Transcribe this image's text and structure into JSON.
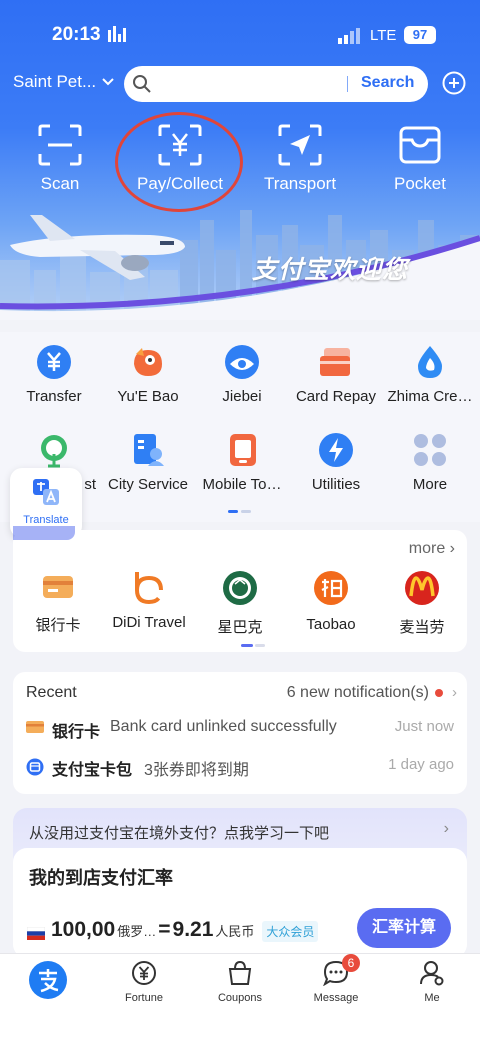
{
  "status": {
    "time": "20:13",
    "network": "LTE",
    "battery": "97"
  },
  "topbar": {
    "city": "Saint Pet...",
    "search_button": "Search"
  },
  "quick": [
    {
      "label": "Scan",
      "icon": "scan-icon"
    },
    {
      "label": "Pay/Collect",
      "icon": "yuan-qr-icon"
    },
    {
      "label": "Transport",
      "icon": "transport-arrow-icon"
    },
    {
      "label": "Pocket",
      "icon": "wallet-icon"
    }
  ],
  "banner": {
    "text": "支付宝欢迎您"
  },
  "grid": [
    {
      "label": "Transfer",
      "icon": "transfer-icon"
    },
    {
      "label": "Yu'E Bao",
      "icon": "yuebao-icon"
    },
    {
      "label": "Jiebei",
      "icon": "jiebei-icon"
    },
    {
      "label": "Card Repay",
      "icon": "card-repay-icon"
    },
    {
      "label": "Zhima Cre…",
      "icon": "zhima-credit-icon"
    },
    {
      "label": "st",
      "icon": "forest-icon"
    },
    {
      "label": "City Service",
      "icon": "city-service-icon"
    },
    {
      "label": "Mobile To…",
      "icon": "mobile-topup-icon"
    },
    {
      "label": "Utilities",
      "icon": "utilities-icon"
    },
    {
      "label": "More",
      "icon": "more-grid-icon"
    }
  ],
  "translate": {
    "label": "Translate"
  },
  "brands": {
    "more": "more",
    "items": [
      {
        "label": "银行卡",
        "icon": "bank-card-icon"
      },
      {
        "label": "DiDi Travel",
        "icon": "didi-icon"
      },
      {
        "label": "星巴克",
        "icon": "starbucks-icon"
      },
      {
        "label": "Taobao",
        "icon": "taobao-icon"
      },
      {
        "label": "麦当劳",
        "icon": "mcdonalds-icon"
      }
    ]
  },
  "recent": {
    "header": "Recent",
    "notifications": "6 new notification(s)",
    "items": [
      {
        "title": "银行卡",
        "desc": "Bank card unlinked successfully",
        "time": "Just now"
      },
      {
        "title": "支付宝卡包",
        "desc": "3张券即将到期",
        "time": "1 day ago"
      }
    ]
  },
  "promo": {
    "question": "从没用过支付宝在境外支付？点我学习一下吧",
    "title": "我的到店支付汇率",
    "amount": "100,00",
    "currency_from": "俄罗…",
    "equals": "=",
    "converted": "9.21",
    "currency_to": "人民币",
    "member": "大众会员",
    "button": "汇率计算"
  },
  "tabs": [
    {
      "label": "",
      "icon": "alipay-home-icon"
    },
    {
      "label": "Fortune",
      "icon": "fortune-icon"
    },
    {
      "label": "Coupons",
      "icon": "coupons-icon"
    },
    {
      "label": "Message",
      "icon": "message-icon",
      "badge": "6"
    },
    {
      "label": "Me",
      "icon": "me-icon"
    }
  ],
  "colors": {
    "brand": "#2f6ff4",
    "accent": "#5a6cf1",
    "alert": "#e84b3c"
  }
}
